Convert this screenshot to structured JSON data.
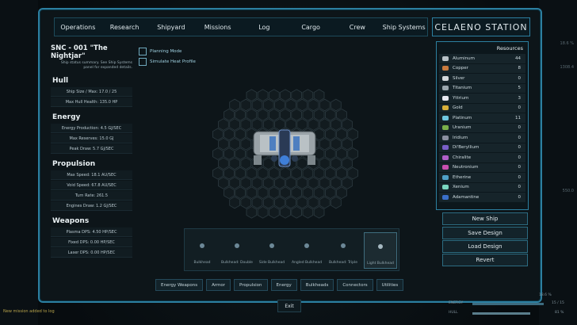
{
  "nav": {
    "tabs": [
      "Operations",
      "Research",
      "Shipyard",
      "Missions",
      "Log",
      "Cargo",
      "Crew",
      "Ship Systems"
    ],
    "station": "CELAENO STATION"
  },
  "ship": {
    "name": "SNC - 001 \"The Nightjar\"",
    "note": "Ship status summary. See Ship Systems panel for expanded details."
  },
  "options": {
    "planning": "Planning Mode",
    "heat": "Simulate Heat Profile"
  },
  "hull": {
    "title": "Hull",
    "stats": [
      "Ship Size / Max: 17.0 / 25",
      "Max Hull Health: 135.0 HP"
    ]
  },
  "energy": {
    "title": "Energy",
    "stats": [
      "Energy Production: 4.5 GJ/SEC",
      "Max Reserves: 15.0 GJ",
      "Peak Draw: 5.7 GJ/SEC"
    ]
  },
  "propulsion": {
    "title": "Propulsion",
    "stats": [
      "Max Speed: 18.1 AU/SEC",
      "Void Speed: 67.8 AU/SEC",
      "Turn Rate: 261.5",
      "Engines Draw: 1.2 GJ/SEC"
    ]
  },
  "weapons": {
    "title": "Weapons",
    "stats": [
      "Plasma DPS: 4.50 HP/SEC",
      "Fixed DPS: 0.00 HP/SEC",
      "Laser DPS: 0.00 HP/SEC"
    ]
  },
  "resources": {
    "title": "Resources",
    "items": [
      {
        "name": "Aluminum",
        "value": "44",
        "color": "#b9c2c7"
      },
      {
        "name": "Copper",
        "value": "8",
        "color": "#c97a3e"
      },
      {
        "name": "Silver",
        "value": "0",
        "color": "#d3d8db"
      },
      {
        "name": "Titanium",
        "value": "5",
        "color": "#9aa6ad"
      },
      {
        "name": "Yttrium",
        "value": "3",
        "color": "#e8e8f0"
      },
      {
        "name": "Gold",
        "value": "0",
        "color": "#d8b03a"
      },
      {
        "name": "Platinum",
        "value": "11",
        "color": "#6fc7e0"
      },
      {
        "name": "Uranium",
        "value": "0",
        "color": "#7bb04a"
      },
      {
        "name": "Iridium",
        "value": "0",
        "color": "#8a8fa0"
      },
      {
        "name": "Di'Beryllium",
        "value": "0",
        "color": "#7a5fc8"
      },
      {
        "name": "Chiralite",
        "value": "0",
        "color": "#b05fc8"
      },
      {
        "name": "Neutronium",
        "value": "0",
        "color": "#c84fb0"
      },
      {
        "name": "Etherine",
        "value": "0",
        "color": "#4fa0c8"
      },
      {
        "name": "Xenium",
        "value": "0",
        "color": "#7ad7c0"
      },
      {
        "name": "Adamantine",
        "value": "0",
        "color": "#3a6fc8"
      }
    ]
  },
  "actions": [
    "New Ship",
    "Save Design",
    "Load Design",
    "Revert"
  ],
  "parts": [
    "Bulkhead",
    "Bulkhead: Double",
    "Side Bulkhead",
    "Angled Bulkhead",
    "Bulkhead: Triple",
    "Light Bulkhead"
  ],
  "categories": [
    "Energy Weapons",
    "Armor",
    "Propulsion",
    "Energy",
    "Bulkheads",
    "Connectors",
    "Utilities"
  ],
  "exit": "Exit",
  "notification": "New mission added to log",
  "hud": {
    "energy_label": "ENERGY",
    "energy_value": "15 / 15",
    "hull_label": "HULL",
    "hull_value": "81 %",
    "speed_partial": "18.6 %",
    "side_vals": [
      "18.6 %",
      "1308.4",
      "550.0"
    ]
  }
}
